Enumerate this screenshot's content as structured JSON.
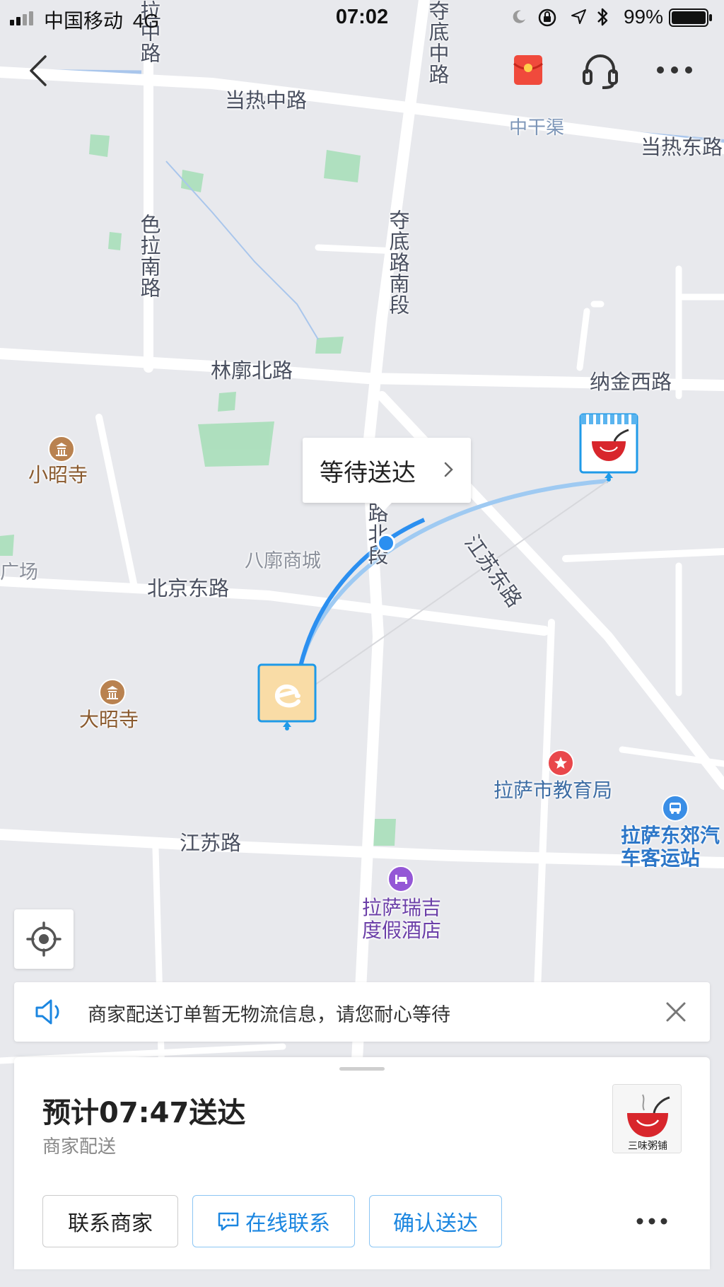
{
  "status_bar": {
    "carrier": "中国移动",
    "network": "4G",
    "time": "07:02",
    "battery": "99%"
  },
  "map": {
    "roads": {
      "dangre_zhong": "当热中路",
      "zhonggan_qu": "中干渠",
      "dangre_dong": "当热东路",
      "sela_nan": "色拉南路",
      "duodi_nanduan": "夺底路南段",
      "duodi_zhong": "夺底中路",
      "la_zhong": "拉中路",
      "linkuo_bei": "林廓北路",
      "najin_xi": "纳金西路",
      "jiangsu_dong": "江苏东路",
      "beijing_dong": "北京东路",
      "jiangsu": "江苏路",
      "road_beiduan": "路北段"
    },
    "areas": {
      "bakuo_mall": "八廓商城",
      "guangchang": "广场"
    },
    "pois": {
      "xiaozhao_temple": "小昭寺",
      "dazhao_temple": "大昭寺",
      "edu_bureau": "拉萨市教育局",
      "bus_station": "拉萨东郊汽车客运站",
      "hotel": "拉萨瑞吉度假酒店"
    }
  },
  "popup": {
    "status": "等待送达"
  },
  "notice": {
    "text": "商家配送订单暂无物流信息，请您耐心等待"
  },
  "order_card": {
    "eta": "预计07:47送达",
    "delivery_mode": "商家配送",
    "shop_logo_text": "三味粥铺"
  },
  "actions": {
    "contact_merchant": "联系商家",
    "online_contact": "在线联系",
    "confirm_delivery": "确认送达"
  },
  "colors": {
    "accent": "#1b86e0",
    "route": "#2b8ff0",
    "red_packet": "#f04a3c"
  }
}
